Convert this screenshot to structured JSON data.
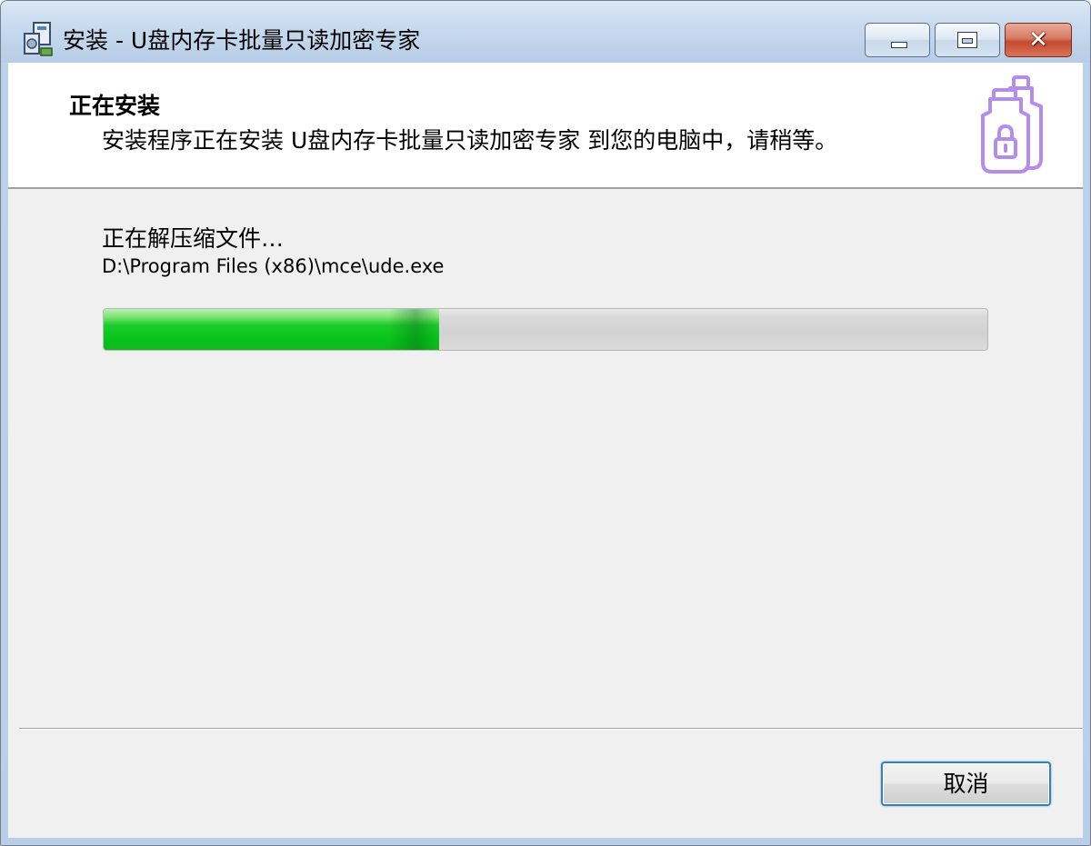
{
  "window": {
    "title": "安装 - U盘内存卡批量只读加密专家",
    "icon": "installer-icon",
    "controls": {
      "minimize": "minimize-icon",
      "maximize": "maximize-icon",
      "close": "close-icon",
      "close_glyph": "✕"
    }
  },
  "header": {
    "title": "正在安装",
    "subtitle": "安装程序正在安装 U盘内存卡批量只读加密专家 到您的电脑中，请稍等。",
    "icon": "usb-lock-icon",
    "icon_color": "#b48cf0"
  },
  "progress": {
    "status": "正在解压缩文件…",
    "current_file": "D:\\Program Files (x86)\\mce\\ude.exe",
    "percent": 38,
    "fill_color": "#06c31a"
  },
  "footer": {
    "cancel_label": "取消"
  }
}
